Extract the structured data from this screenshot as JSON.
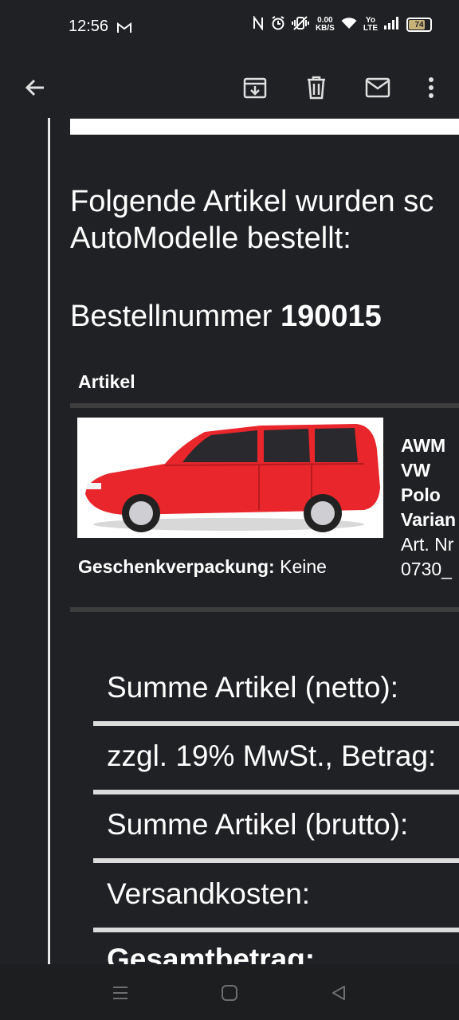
{
  "status_bar": {
    "time": "12:56",
    "net_speed_value": "0.00",
    "net_speed_unit": "KB/S",
    "volte_top": "Yo",
    "volte_bottom": "LTE",
    "battery": "74"
  },
  "toolbar": {
    "icons": [
      "back-arrow-icon",
      "archive-icon",
      "delete-icon",
      "mark-unread-icon",
      "more-vert-icon"
    ]
  },
  "email": {
    "heading_line1": "Folgende Artikel wurden sc",
    "heading_line2": "AutoModelle bestellt:",
    "order_label": "Bestellnummer",
    "order_number": "190015",
    "table_header": "Artikel",
    "product": {
      "name_lines": [
        "AWM",
        "VW",
        "Polo",
        "Varian"
      ],
      "meta_lines": [
        "Art. Nr",
        "0730_"
      ],
      "gift_label": "Geschenkverpackung:",
      "gift_value": "Keine",
      "image_icon": "red-car-photo"
    },
    "summary": [
      "Summe Artikel (netto):",
      "zzgl. 19% MwSt., Betrag:",
      "Summe Artikel (brutto):",
      "Versandkosten:",
      "Gesamtbetrag:"
    ]
  },
  "colors": {
    "background": "#202124",
    "car_red": "#e8262b"
  }
}
